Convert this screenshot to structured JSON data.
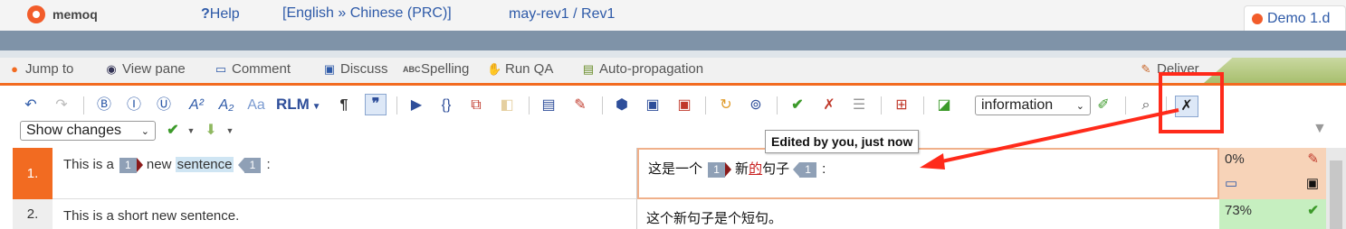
{
  "app": {
    "name": "memoq"
  },
  "topbar": {
    "help_label": "Help",
    "language_pair": "[English » Chinese (PRC)]",
    "project_path": "may-rev1 / Rev1",
    "doc_tab": "Demo 1.d"
  },
  "menu": {
    "jump_to": "Jump to",
    "view_pane": "View pane",
    "comment": "Comment",
    "discuss": "Discuss",
    "spelling": "Spelling",
    "run_qa": "Run QA",
    "auto_propagation": "Auto-propagation",
    "deliver": "Deliver"
  },
  "toolbar": {
    "rlm_label": "RLM",
    "info_combo": "information",
    "show_changes": "Show changes"
  },
  "tooltip": {
    "text": "Edited by you, just now"
  },
  "segments": [
    {
      "num": "1.",
      "src_before": "This is a",
      "src_tag_open": "1",
      "src_mid": "new",
      "src_highlight": "sentence",
      "src_tag_close": "1",
      "src_after": ":",
      "tgt_before": "这是一个",
      "tgt_tag_open": "1",
      "tgt_a": "新",
      "tgt_ins": "的",
      "tgt_b": "句子",
      "tgt_tag_close": "1",
      "tgt_after": ":",
      "match": "0%",
      "colors": {
        "num_bg": "#f26b21",
        "stat_bg": "#f7d3b8"
      }
    },
    {
      "num": "2.",
      "src": "This is a short new sentence.",
      "tgt": "这个新句子是个短句。",
      "match": "73%",
      "colors": {
        "num_bg": "#eeeeee",
        "stat_bg": "#c6efc0"
      }
    }
  ]
}
